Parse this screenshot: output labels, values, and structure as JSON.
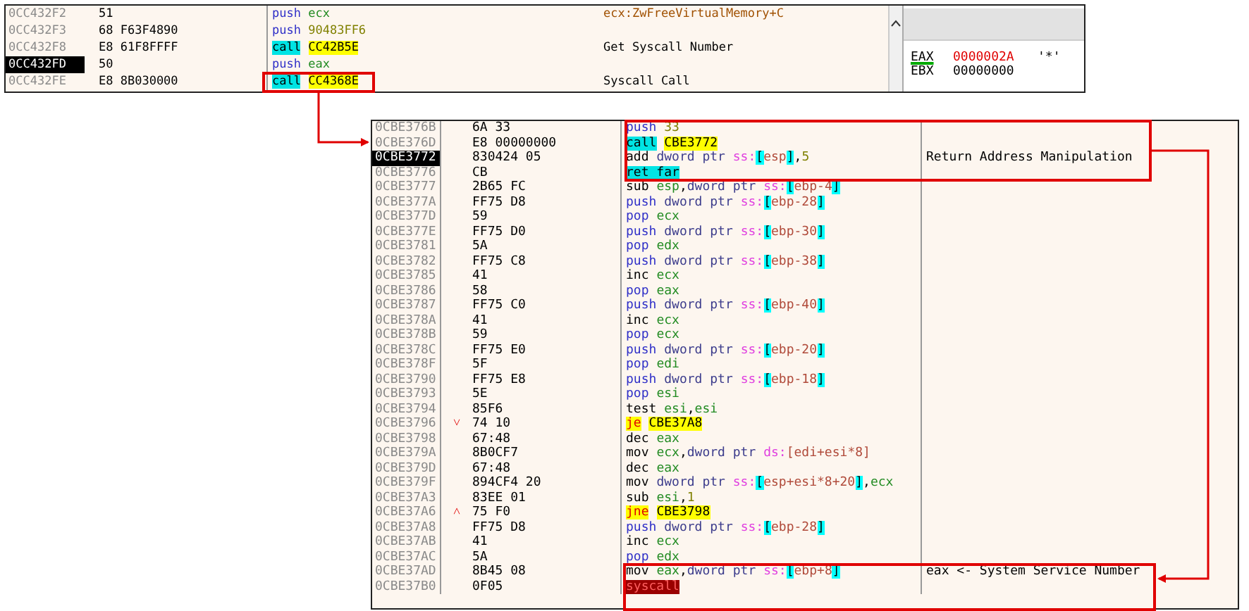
{
  "top_panel": {
    "rows": [
      {
        "address": "0CC432F2",
        "bytes": "51",
        "selected": false,
        "ins": [
          {
            "kind": "stack",
            "text": "push"
          },
          {
            "kind": "reg",
            "text": "ecx"
          }
        ],
        "comment": {
          "kind": "symbol",
          "text": "ecx:ZwFreeVirtualMemory+C"
        }
      },
      {
        "address": "0CC432F3",
        "bytes": "68 F63F4890",
        "selected": false,
        "ins": [
          {
            "kind": "stack",
            "text": "push"
          },
          {
            "kind": "num",
            "text": "90483FF6"
          }
        ]
      },
      {
        "address": "0CC432F8",
        "bytes": "E8 61F8FFFF",
        "selected": false,
        "ins": [
          {
            "kind": "call",
            "text": "call"
          },
          {
            "kind": "target",
            "text": "CC42B5E"
          }
        ],
        "comment": {
          "kind": "note",
          "text": "Get Syscall Number"
        }
      },
      {
        "address": "0CC432FD",
        "bytes": "50",
        "selected": true,
        "ins": [
          {
            "kind": "stack",
            "text": "push"
          },
          {
            "kind": "reg",
            "text": "eax"
          }
        ]
      },
      {
        "address": "0CC432FE",
        "bytes": "E8 8B030000",
        "selected": false,
        "ins": [
          {
            "kind": "call",
            "text": "call"
          },
          {
            "kind": "target",
            "text": "CC4368E"
          }
        ],
        "comment": {
          "kind": "note",
          "text": "Syscall Call"
        }
      }
    ],
    "registers": [
      {
        "name": "EAX",
        "value": "0000002A",
        "ascii": "'*'",
        "selected": true,
        "changed": true
      },
      {
        "name": "EBX",
        "value": "00000000",
        "selected": false,
        "changed": false
      }
    ]
  },
  "bottom_panel": {
    "rows": [
      {
        "address": "0CBE376B",
        "bytes": "6A 33",
        "selected": false,
        "ins": [
          {
            "kind": "stack",
            "text": "push"
          },
          {
            "kind": "num",
            "text": "33"
          }
        ]
      },
      {
        "address": "0CBE376D",
        "bytes": "E8 00000000",
        "selected": false,
        "ins": [
          {
            "kind": "call",
            "text": "call"
          },
          {
            "kind": "target",
            "text": "CBE3772"
          }
        ]
      },
      {
        "address": "0CBE3772",
        "bytes": "830424 05",
        "selected": true,
        "ins": [
          {
            "kind": "op",
            "text": "add"
          },
          {
            "kind": "ptr",
            "text": "dword ptr"
          },
          {
            "kind": "seg",
            "text": "ss:"
          },
          {
            "kind": "bracket",
            "text": "["
          },
          {
            "kind": "mem",
            "text": "esp"
          },
          {
            "kind": "bracket",
            "text": "]"
          },
          {
            "kind": "punct",
            "text": ","
          },
          {
            "kind": "num",
            "text": "5"
          }
        ],
        "comment": {
          "kind": "note",
          "text": "Return Address Manipulation"
        }
      },
      {
        "address": "0CBE3776",
        "bytes": "CB",
        "selected": false,
        "ins": [
          {
            "kind": "ret",
            "text": "ret far"
          }
        ]
      },
      {
        "address": "0CBE3777",
        "bytes": "2B65 FC",
        "selected": false,
        "ins": [
          {
            "kind": "op",
            "text": "sub"
          },
          {
            "kind": "reg",
            "text": "esp"
          },
          {
            "kind": "punct",
            "text": ","
          },
          {
            "kind": "ptr",
            "text": "dword ptr"
          },
          {
            "kind": "seg",
            "text": "ss:"
          },
          {
            "kind": "bracket",
            "text": "["
          },
          {
            "kind": "mem",
            "text": "ebp-4"
          },
          {
            "kind": "bracket",
            "text": "]"
          }
        ]
      },
      {
        "address": "0CBE377A",
        "bytes": "FF75 D8",
        "selected": false,
        "ins": [
          {
            "kind": "stack",
            "text": "push"
          },
          {
            "kind": "ptr",
            "text": "dword ptr"
          },
          {
            "kind": "seg",
            "text": "ss:"
          },
          {
            "kind": "bracket",
            "text": "["
          },
          {
            "kind": "mem",
            "text": "ebp-28"
          },
          {
            "kind": "bracket",
            "text": "]"
          }
        ]
      },
      {
        "address": "0CBE377D",
        "bytes": "59",
        "selected": false,
        "ins": [
          {
            "kind": "stack",
            "text": "pop"
          },
          {
            "kind": "reg",
            "text": "ecx"
          }
        ]
      },
      {
        "address": "0CBE377E",
        "bytes": "FF75 D0",
        "selected": false,
        "ins": [
          {
            "kind": "stack",
            "text": "push"
          },
          {
            "kind": "ptr",
            "text": "dword ptr"
          },
          {
            "kind": "seg",
            "text": "ss:"
          },
          {
            "kind": "bracket",
            "text": "["
          },
          {
            "kind": "mem",
            "text": "ebp-30"
          },
          {
            "kind": "bracket",
            "text": "]"
          }
        ]
      },
      {
        "address": "0CBE3781",
        "bytes": "5A",
        "selected": false,
        "ins": [
          {
            "kind": "stack",
            "text": "pop"
          },
          {
            "kind": "reg",
            "text": "edx"
          }
        ]
      },
      {
        "address": "0CBE3782",
        "bytes": "FF75 C8",
        "selected": false,
        "ins": [
          {
            "kind": "stack",
            "text": "push"
          },
          {
            "kind": "ptr",
            "text": "dword ptr"
          },
          {
            "kind": "seg",
            "text": "ss:"
          },
          {
            "kind": "bracket",
            "text": "["
          },
          {
            "kind": "mem",
            "text": "ebp-38"
          },
          {
            "kind": "bracket",
            "text": "]"
          }
        ]
      },
      {
        "address": "0CBE3785",
        "bytes": "41",
        "selected": false,
        "ins": [
          {
            "kind": "op",
            "text": "inc"
          },
          {
            "kind": "reg",
            "text": "ecx"
          }
        ]
      },
      {
        "address": "0CBE3786",
        "bytes": "58",
        "selected": false,
        "ins": [
          {
            "kind": "stack",
            "text": "pop"
          },
          {
            "kind": "reg",
            "text": "eax"
          }
        ]
      },
      {
        "address": "0CBE3787",
        "bytes": "FF75 C0",
        "selected": false,
        "ins": [
          {
            "kind": "stack",
            "text": "push"
          },
          {
            "kind": "ptr",
            "text": "dword ptr"
          },
          {
            "kind": "seg",
            "text": "ss:"
          },
          {
            "kind": "bracket",
            "text": "["
          },
          {
            "kind": "mem",
            "text": "ebp-40"
          },
          {
            "kind": "bracket",
            "text": "]"
          }
        ]
      },
      {
        "address": "0CBE378A",
        "bytes": "41",
        "selected": false,
        "ins": [
          {
            "kind": "op",
            "text": "inc"
          },
          {
            "kind": "reg",
            "text": "ecx"
          }
        ]
      },
      {
        "address": "0CBE378B",
        "bytes": "59",
        "selected": false,
        "ins": [
          {
            "kind": "stack",
            "text": "pop"
          },
          {
            "kind": "reg",
            "text": "ecx"
          }
        ]
      },
      {
        "address": "0CBE378C",
        "bytes": "FF75 E0",
        "selected": false,
        "ins": [
          {
            "kind": "stack",
            "text": "push"
          },
          {
            "kind": "ptr",
            "text": "dword ptr"
          },
          {
            "kind": "seg",
            "text": "ss:"
          },
          {
            "kind": "bracket",
            "text": "["
          },
          {
            "kind": "mem",
            "text": "ebp-20"
          },
          {
            "kind": "bracket",
            "text": "]"
          }
        ]
      },
      {
        "address": "0CBE378F",
        "bytes": "5F",
        "selected": false,
        "ins": [
          {
            "kind": "stack",
            "text": "pop"
          },
          {
            "kind": "reg",
            "text": "edi"
          }
        ]
      },
      {
        "address": "0CBE3790",
        "bytes": "FF75 E8",
        "selected": false,
        "ins": [
          {
            "kind": "stack",
            "text": "push"
          },
          {
            "kind": "ptr",
            "text": "dword ptr"
          },
          {
            "kind": "seg",
            "text": "ss:"
          },
          {
            "kind": "bracket",
            "text": "["
          },
          {
            "kind": "mem",
            "text": "ebp-18"
          },
          {
            "kind": "bracket",
            "text": "]"
          }
        ]
      },
      {
        "address": "0CBE3793",
        "bytes": "5E",
        "selected": false,
        "ins": [
          {
            "kind": "stack",
            "text": "pop"
          },
          {
            "kind": "reg",
            "text": "esi"
          }
        ]
      },
      {
        "address": "0CBE3794",
        "bytes": "85F6",
        "selected": false,
        "ins": [
          {
            "kind": "op",
            "text": "test"
          },
          {
            "kind": "reg",
            "text": "esi"
          },
          {
            "kind": "punct",
            "text": ","
          },
          {
            "kind": "reg",
            "text": "esi"
          }
        ]
      },
      {
        "address": "0CBE3796",
        "bytes": "74 10",
        "marker": "˅",
        "selected": false,
        "ins": [
          {
            "kind": "jump",
            "text": "je"
          },
          {
            "kind": "target",
            "text": "CBE37A8"
          }
        ]
      },
      {
        "address": "0CBE3798",
        "bytes": "67:48",
        "selected": false,
        "ins": [
          {
            "kind": "op",
            "text": "dec"
          },
          {
            "kind": "reg",
            "text": "eax"
          }
        ]
      },
      {
        "address": "0CBE379A",
        "bytes": "8B0CF7",
        "selected": false,
        "ins": [
          {
            "kind": "op",
            "text": "mov"
          },
          {
            "kind": "reg",
            "text": "ecx"
          },
          {
            "kind": "punct",
            "text": ","
          },
          {
            "kind": "ptr",
            "text": "dword ptr"
          },
          {
            "kind": "seg",
            "text": "ds:"
          },
          {
            "kind": "mem",
            "text": "[edi+esi*8]"
          }
        ]
      },
      {
        "address": "0CBE379D",
        "bytes": "67:48",
        "selected": false,
        "ins": [
          {
            "kind": "op",
            "text": "dec"
          },
          {
            "kind": "reg",
            "text": "eax"
          }
        ]
      },
      {
        "address": "0CBE379F",
        "bytes": "894CF4 20",
        "selected": false,
        "ins": [
          {
            "kind": "op",
            "text": "mov"
          },
          {
            "kind": "ptr",
            "text": "dword ptr"
          },
          {
            "kind": "seg",
            "text": "ss:"
          },
          {
            "kind": "bracket",
            "text": "["
          },
          {
            "kind": "mem",
            "text": "esp+esi*8+20"
          },
          {
            "kind": "bracket",
            "text": "]"
          },
          {
            "kind": "punct",
            "text": ","
          },
          {
            "kind": "reg",
            "text": "ecx"
          }
        ]
      },
      {
        "address": "0CBE37A3",
        "bytes": "83EE 01",
        "selected": false,
        "ins": [
          {
            "kind": "op",
            "text": "sub"
          },
          {
            "kind": "reg",
            "text": "esi"
          },
          {
            "kind": "punct",
            "text": ","
          },
          {
            "kind": "num",
            "text": "1"
          }
        ]
      },
      {
        "address": "0CBE37A6",
        "bytes": "75 F0",
        "marker": "˄",
        "selected": false,
        "ins": [
          {
            "kind": "jump",
            "text": "jne"
          },
          {
            "kind": "target",
            "text": "CBE3798"
          }
        ]
      },
      {
        "address": "0CBE37A8",
        "bytes": "FF75 D8",
        "selected": false,
        "ins": [
          {
            "kind": "stack",
            "text": "push"
          },
          {
            "kind": "ptr",
            "text": "dword ptr"
          },
          {
            "kind": "seg",
            "text": "ss:"
          },
          {
            "kind": "bracket",
            "text": "["
          },
          {
            "kind": "mem",
            "text": "ebp-28"
          },
          {
            "kind": "bracket",
            "text": "]"
          }
        ]
      },
      {
        "address": "0CBE37AB",
        "bytes": "41",
        "selected": false,
        "ins": [
          {
            "kind": "op",
            "text": "inc"
          },
          {
            "kind": "reg",
            "text": "ecx"
          }
        ]
      },
      {
        "address": "0CBE37AC",
        "bytes": "5A",
        "selected": false,
        "ins": [
          {
            "kind": "stack",
            "text": "pop"
          },
          {
            "kind": "reg",
            "text": "edx"
          }
        ]
      },
      {
        "address": "0CBE37AD",
        "bytes": "8B45 08",
        "selected": false,
        "ins": [
          {
            "kind": "op",
            "text": "mov"
          },
          {
            "kind": "reg",
            "text": "eax"
          },
          {
            "kind": "punct",
            "text": ","
          },
          {
            "kind": "ptr",
            "text": "dword ptr"
          },
          {
            "kind": "seg",
            "text": "ss:"
          },
          {
            "kind": "bracket",
            "text": "["
          },
          {
            "kind": "mem",
            "text": "ebp+8"
          },
          {
            "kind": "bracket",
            "text": "]"
          }
        ],
        "comment": {
          "kind": "note",
          "text": "eax <- System Service Number"
        }
      },
      {
        "address": "0CBE37B0",
        "bytes": "0F05",
        "selected": false,
        "ins": [
          {
            "kind": "sys",
            "text": "syscall"
          }
        ]
      }
    ]
  }
}
